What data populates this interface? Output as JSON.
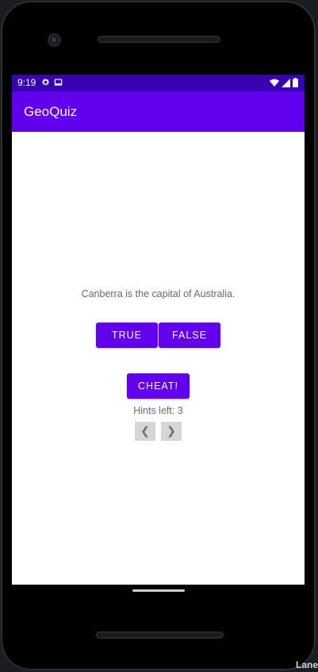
{
  "status_bar": {
    "time": "9:19",
    "left_icons": [
      "gear-icon",
      "notification-icon"
    ],
    "right_icons": [
      "wifi-icon",
      "signal-icon",
      "battery-icon"
    ]
  },
  "app_bar": {
    "title": "GeoQuiz"
  },
  "quiz": {
    "question": "Canberra is the capital of Australia.",
    "true_label": "TRUE",
    "false_label": "FALSE",
    "cheat_label": "CHEAT!",
    "hints_text": "Hints left: 3",
    "prev_label": "❮",
    "next_label": "❯"
  },
  "background_text": "Lane",
  "colors": {
    "primary": "#6200ee",
    "status_bar": "#3700b3",
    "text_secondary": "#6b6b6b",
    "nav_button_bg": "#d6d6d6"
  }
}
